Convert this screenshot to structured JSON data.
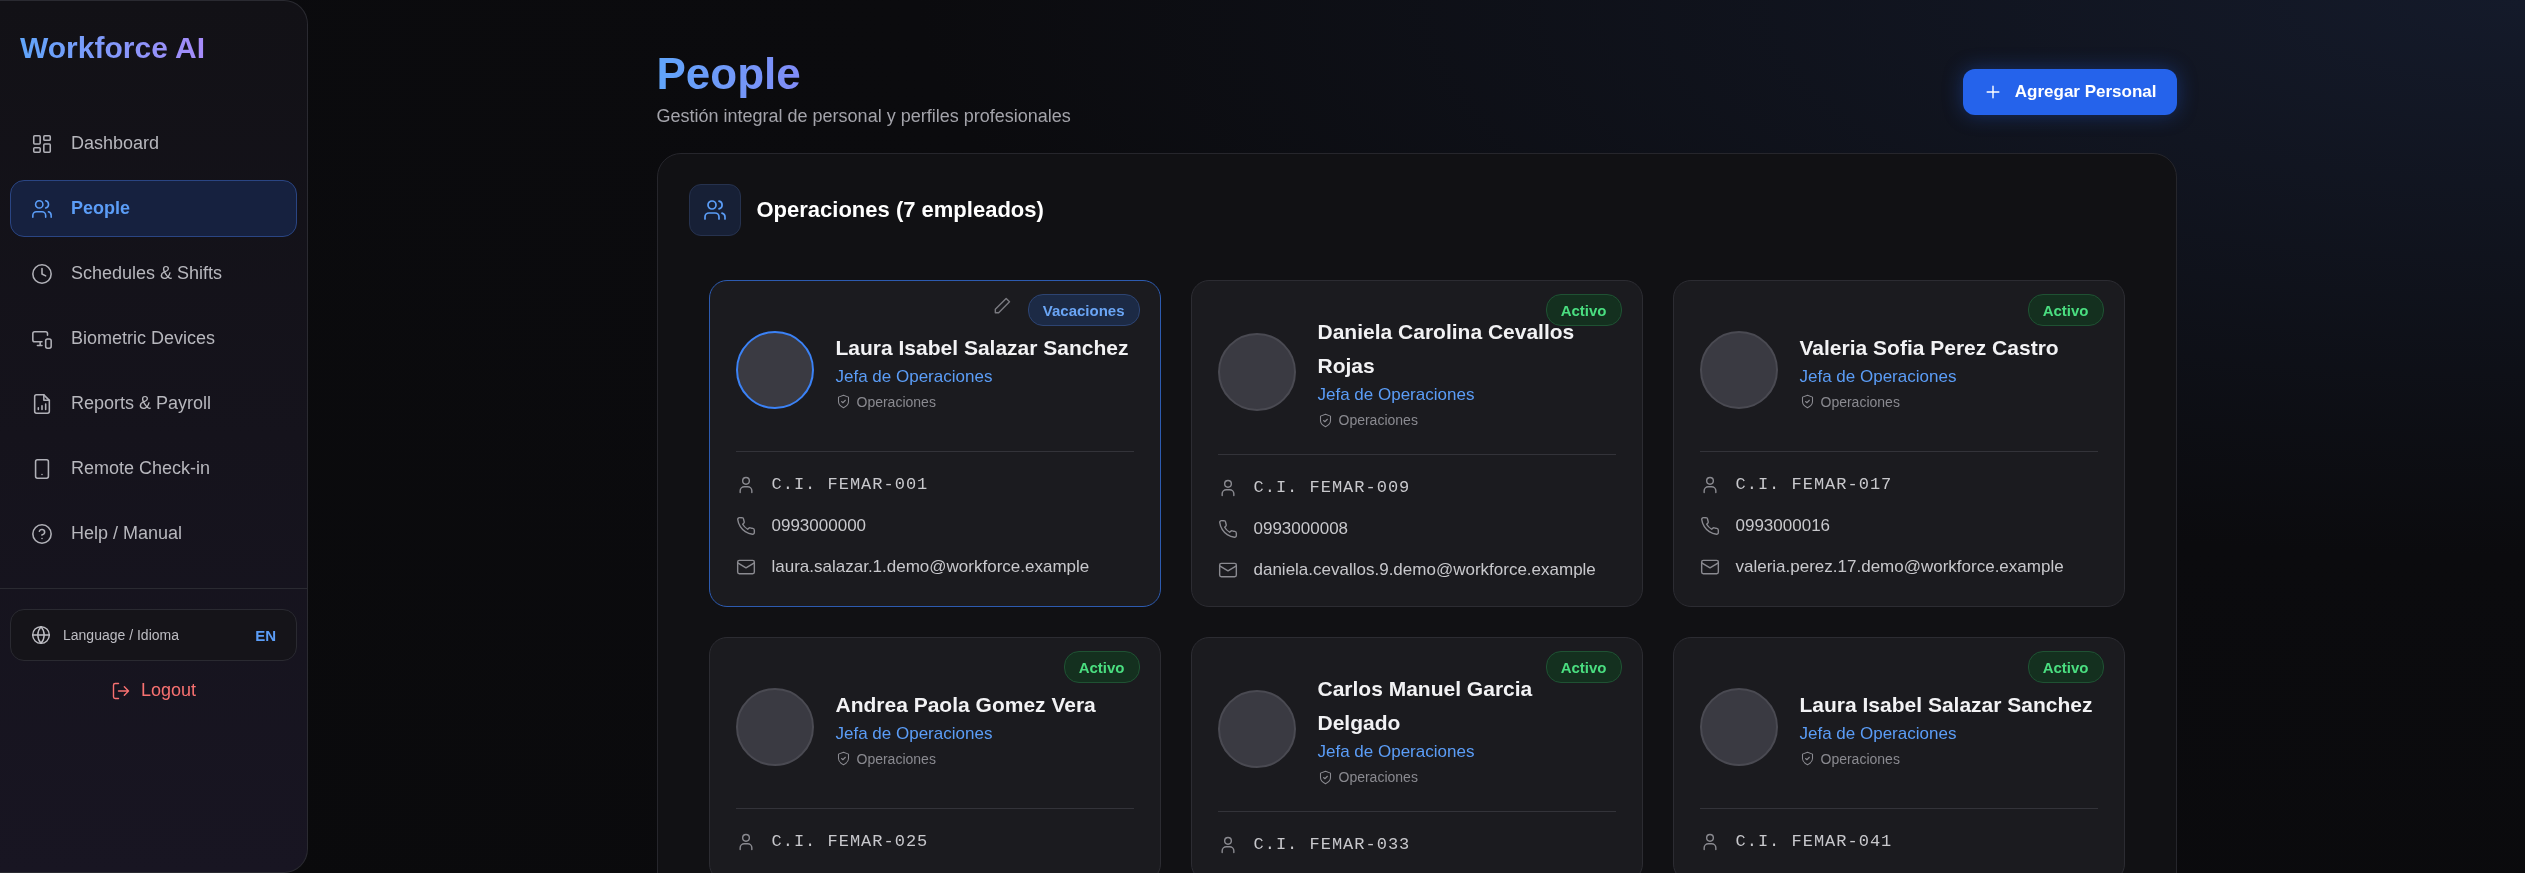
{
  "sidebar": {
    "logo": "Workforce AI",
    "items": [
      {
        "label": "Dashboard",
        "kind": "grid",
        "selected": false
      },
      {
        "label": "People",
        "kind": "users",
        "selected": true
      },
      {
        "label": "Schedules & Shifts",
        "kind": "clock",
        "selected": false
      },
      {
        "label": "Biometric Devices",
        "kind": "devices",
        "selected": false
      },
      {
        "label": "Reports & Payroll",
        "kind": "report",
        "selected": false
      },
      {
        "label": "Remote Check-in",
        "kind": "phone",
        "selected": false
      },
      {
        "label": "Help / Manual",
        "kind": "help",
        "selected": false
      }
    ],
    "language": {
      "label": "Language / Idioma",
      "value": "EN"
    },
    "logout": "Logout"
  },
  "header": {
    "title": "People",
    "subtitle": "Gestión integral de personal y perfiles profesionales",
    "button": "Agregar Personal"
  },
  "section": {
    "title": "Operaciones (7 empleados)",
    "cards": [
      {
        "name": "Laura Isabel Salazar Sanchez",
        "role": "Jefa de Operaciones",
        "department": "Operaciones",
        "status": "Vacaciones",
        "kind": "vacation",
        "selected": true,
        "id": "C.I. FEMAR-001",
        "phone": "0993000000",
        "email": "laura.salazar.1.demo@workforce.example"
      },
      {
        "name": "Daniela Carolina Cevallos Rojas",
        "role": "Jefa de Operaciones",
        "department": "Operaciones",
        "status": "Activo",
        "kind": "active",
        "selected": false,
        "id": "C.I. FEMAR-009",
        "phone": "0993000008",
        "email": "daniela.cevallos.9.demo@workforce.example"
      },
      {
        "name": "Valeria Sofia Perez Castro",
        "role": "Jefa de Operaciones",
        "department": "Operaciones",
        "status": "Activo",
        "kind": "active",
        "selected": false,
        "id": "C.I. FEMAR-017",
        "phone": "0993000016",
        "email": "valeria.perez.17.demo@workforce.example"
      },
      {
        "name": "Andrea Paola Gomez Vera",
        "role": "Jefa de Operaciones",
        "department": "Operaciones",
        "status": "Activo",
        "kind": "active",
        "selected": false,
        "id": "C.I. FEMAR-025"
      },
      {
        "name": "Carlos Manuel Garcia Delgado",
        "role": "Jefa de Operaciones",
        "department": "Operaciones",
        "status": "Activo",
        "kind": "active",
        "selected": false,
        "id": "C.I. FEMAR-033"
      },
      {
        "name": "Laura Isabel Salazar Sanchez",
        "role": "Jefa de Operaciones",
        "department": "Operaciones",
        "status": "Activo",
        "kind": "active",
        "selected": false,
        "id": "C.I. FEMAR-041"
      }
    ]
  }
}
